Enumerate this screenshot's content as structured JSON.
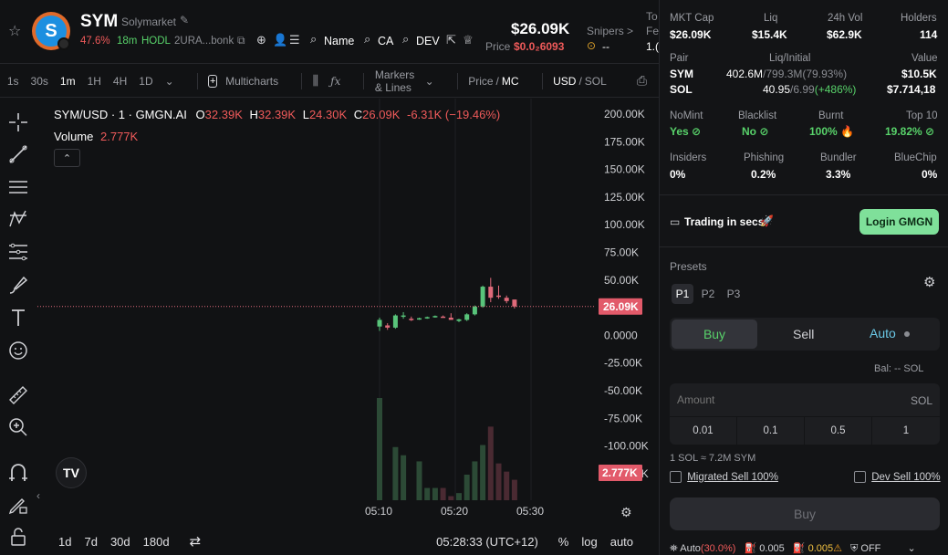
{
  "header": {
    "symbol": "SYM",
    "name": "Solymarket",
    "change_pct": "47.6%",
    "age": "18m",
    "hodl": "HODL",
    "address": "2URA...bonk",
    "links": [
      "Name",
      "CA",
      "DEV"
    ],
    "price_big": "$26.09K",
    "price_label": "Price",
    "price_small": "$0.0₂6093",
    "snipers_label": "Snipers >",
    "snipers_value": "--",
    "cut_label_1": "To",
    "cut_label_2": "Fe",
    "cut_value": "1.("
  },
  "toolbar": {
    "intervals": [
      "1s",
      "30s",
      "1m",
      "1H",
      "4H",
      "1D"
    ],
    "active_interval": "1m",
    "multicharts": "Multicharts",
    "markers": "Markers & Lines",
    "price_mc_a": "Price",
    "price_mc_b": "MC",
    "usd": "USD",
    "sol": "SOL"
  },
  "legend": {
    "pair": "SYM/USD · 1 · GMGN.AI",
    "o_label": "O",
    "o": "32.39K",
    "h_label": "H",
    "h": "32.39K",
    "l_label": "L",
    "l": "24.30K",
    "c_label": "C",
    "c": "26.09K",
    "delta": "-6.31K (−19.46%)",
    "volume_label": "Volume",
    "volume_value": "2.777K"
  },
  "chart_data": {
    "type": "candlestick",
    "y_ticks": [
      "200.00K",
      "175.00K",
      "150.00K",
      "125.00K",
      "100.00K",
      "75.00K",
      "50.00K",
      "25.00K",
      "0.0000",
      "-25.00K",
      "-50.00K",
      "-75.00K",
      "-100.00K",
      "-125.00K"
    ],
    "ylim": [
      -125000,
      200000
    ],
    "x_ticks": [
      "05:10",
      "05:20",
      "05:30"
    ],
    "last_price_label": "26.09K",
    "last_volume_label": "2.777K",
    "candles": [
      {
        "o": 8000,
        "h": 16000,
        "l": 4000,
        "c": 14000,
        "up": true
      },
      {
        "o": 9000,
        "h": 11000,
        "l": 5000,
        "c": 7000,
        "up": false
      },
      {
        "o": 7000,
        "h": 19000,
        "l": 6000,
        "c": 18000,
        "up": true
      },
      {
        "o": 17000,
        "h": 21000,
        "l": 15000,
        "c": 18000,
        "up": true
      },
      {
        "o": 15000,
        "h": 17000,
        "l": 13000,
        "c": 14000,
        "up": false
      },
      {
        "o": 15000,
        "h": 16000,
        "l": 14000,
        "c": 15500,
        "up": true
      },
      {
        "o": 16000,
        "h": 17000,
        "l": 15000,
        "c": 16500,
        "up": true
      },
      {
        "o": 17000,
        "h": 18000,
        "l": 16000,
        "c": 17500,
        "up": true
      },
      {
        "o": 17000,
        "h": 18000,
        "l": 16000,
        "c": 16800,
        "up": false
      },
      {
        "o": 16000,
        "h": 20000,
        "l": 15000,
        "c": 14000,
        "up": false
      },
      {
        "o": 13000,
        "h": 15000,
        "l": 12000,
        "c": 14500,
        "up": true
      },
      {
        "o": 14000,
        "h": 20000,
        "l": 13000,
        "c": 19000,
        "up": true
      },
      {
        "o": 19000,
        "h": 27000,
        "l": 18000,
        "c": 26000,
        "up": true
      },
      {
        "o": 26000,
        "h": 45000,
        "l": 25000,
        "c": 44000,
        "up": true
      },
      {
        "o": 44000,
        "h": 52000,
        "l": 30000,
        "c": 34000,
        "up": false
      },
      {
        "o": 36000,
        "h": 45000,
        "l": 33000,
        "c": 35000,
        "up": false
      },
      {
        "o": 34000,
        "h": 36000,
        "l": 29000,
        "c": 31000,
        "up": false
      },
      {
        "o": 32390,
        "h": 32390,
        "l": 24300,
        "c": 26090,
        "up": false
      }
    ],
    "volumes": [
      {
        "v": 1.0,
        "up": true
      },
      {
        "v": 0.0,
        "up": true
      },
      {
        "v": 0.52,
        "up": true
      },
      {
        "v": 0.44,
        "up": true
      },
      {
        "v": 0.0,
        "up": false
      },
      {
        "v": 0.38,
        "up": true
      },
      {
        "v": 0.12,
        "up": true
      },
      {
        "v": 0.12,
        "up": true
      },
      {
        "v": 0.12,
        "up": false
      },
      {
        "v": 0.04,
        "up": false
      },
      {
        "v": 0.07,
        "up": true
      },
      {
        "v": 0.25,
        "up": true
      },
      {
        "v": 0.38,
        "up": true
      },
      {
        "v": 0.54,
        "up": true
      },
      {
        "v": 0.72,
        "up": false
      },
      {
        "v": 0.36,
        "up": false
      },
      {
        "v": 0.28,
        "up": false
      },
      {
        "v": 0.2,
        "up": false
      }
    ]
  },
  "bottom": {
    "ranges": [
      "1d",
      "7d",
      "30d",
      "180d"
    ],
    "time": "05:28:33 (UTC+12)",
    "pct": "%",
    "log": "log",
    "auto": "auto"
  },
  "panel": {
    "stats_row1": [
      {
        "label": "MKT Cap",
        "value": "$26.09K"
      },
      {
        "label": "Liq",
        "value": "$15.4K"
      },
      {
        "label": "24h Vol",
        "value": "$62.9K"
      },
      {
        "label": "Holders",
        "value": "114"
      }
    ],
    "pair_header": {
      "pair": "Pair",
      "liq": "Liq/Initial",
      "value": "Value"
    },
    "pair_rows": [
      {
        "token": "SYM",
        "liq_a": "402.6M",
        "liq_b": "/799.3M",
        "liq_c": "(79.93%)",
        "value": "$10.5K"
      },
      {
        "token": "SOL",
        "liq_a": "40.95",
        "liq_b": "/6.99",
        "liq_c": "(+486%)",
        "value": "$7.714,18"
      }
    ],
    "stats_row2": [
      {
        "label": "NoMint",
        "value": "Yes"
      },
      {
        "label": "Blacklist",
        "value": "No"
      },
      {
        "label": "Burnt",
        "value": "100%"
      },
      {
        "label": "Top 10",
        "value": "19.82%"
      }
    ],
    "stats_row3": [
      {
        "label": "Insiders",
        "value": "0%"
      },
      {
        "label": "Phishing",
        "value": "0.2%"
      },
      {
        "label": "Bundler",
        "value": "3.3%"
      },
      {
        "label": "BlueChip",
        "value": "0%"
      }
    ],
    "trading_in_secs": "Trading in secs",
    "login": "Login GMGN",
    "presets_label": "Presets",
    "presets": [
      "P1",
      "P2",
      "P3"
    ],
    "tabs": [
      "Buy",
      "Sell",
      "Auto"
    ],
    "balance": "Bal: -- SOL",
    "amount_placeholder": "Amount",
    "amount_unit": "SOL",
    "quick_amounts": [
      "0.01",
      "0.1",
      "0.5",
      "1"
    ],
    "rate": "1 SOL ≈ 7.2M SYM",
    "migrated_sell": "Migrated Sell 100%",
    "dev_sell": "Dev Sell 100%",
    "buy_button": "Buy",
    "footer_auto": "Auto",
    "footer_auto_pct": "(30.0%)",
    "footer_fee1": "0.005",
    "footer_fee2": "0.005",
    "footer_off": "OFF"
  }
}
